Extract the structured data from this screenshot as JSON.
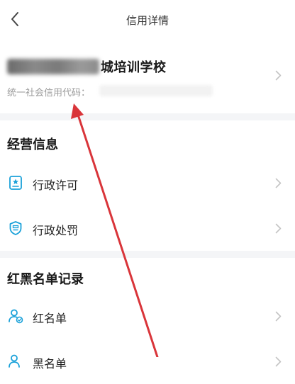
{
  "header": {
    "title": "信用详情",
    "back_icon": "chevron-left-icon"
  },
  "company": {
    "name_visible": "城培训学校",
    "credit_code_label": "统一社会信用代码："
  },
  "sections": {
    "business": {
      "title": "经营信息",
      "items": [
        {
          "label": "行政许可",
          "icon": "license-icon"
        },
        {
          "label": "行政处罚",
          "icon": "penalty-shield-icon"
        }
      ]
    },
    "redblack": {
      "title": "红黑名单记录",
      "items": [
        {
          "label": "红名单",
          "icon": "person-check-icon"
        },
        {
          "label": "黑名单",
          "icon": "person-icon"
        }
      ]
    }
  },
  "colors": {
    "accent": "#1aa1d9",
    "arrow": "#d9353a",
    "separator": "#f4f5f7",
    "muted": "#9a9a9a"
  }
}
